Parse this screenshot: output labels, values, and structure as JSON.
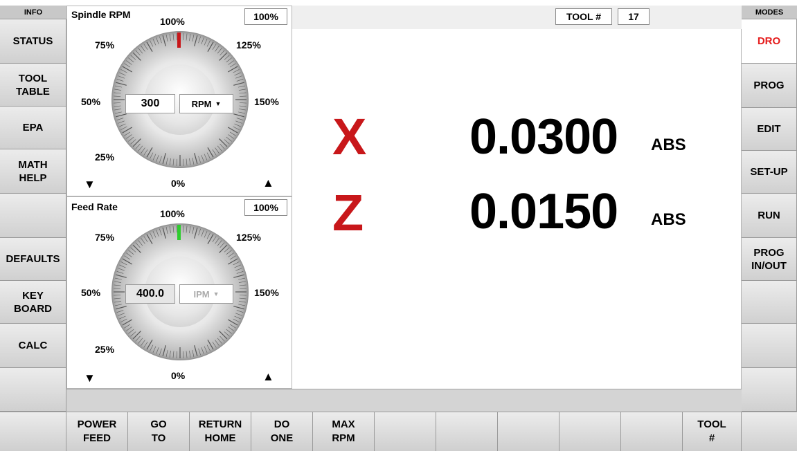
{
  "left_sidebar": {
    "header": "INFO",
    "buttons": [
      {
        "label": "STATUS"
      },
      {
        "label": "TOOL\nTABLE"
      },
      {
        "label": "EPA"
      },
      {
        "label": "MATH\nHELP"
      },
      {
        "label": ""
      },
      {
        "label": "DEFAULTS"
      },
      {
        "label": "KEY\nBOARD"
      },
      {
        "label": "CALC"
      },
      {
        "label": ""
      }
    ]
  },
  "right_sidebar": {
    "header": "MODES",
    "buttons": [
      {
        "label": "DRO"
      },
      {
        "label": "PROG"
      },
      {
        "label": "EDIT"
      },
      {
        "label": "SET-UP"
      },
      {
        "label": "RUN"
      },
      {
        "label": "PROG\nIN/OUT"
      },
      {
        "label": ""
      },
      {
        "label": ""
      },
      {
        "label": ""
      }
    ]
  },
  "spindle": {
    "title": "Spindle RPM",
    "override_pct": "100%",
    "top_label": "100%",
    "labels": {
      "p75": "75%",
      "p125": "125%",
      "p50": "50%",
      "p150": "150%",
      "p25": "25%",
      "p0": "0%"
    },
    "value": "300",
    "unit": "RPM",
    "down_arrow": "▼",
    "up_arrow": "▲",
    "dropdown_arrow": "▼",
    "marker_color": "#c8171a",
    "level": 1.0
  },
  "feed": {
    "title": "Feed Rate",
    "override_pct": "100%",
    "top_label": "100%",
    "labels": {
      "p75": "75%",
      "p125": "125%",
      "p50": "50%",
      "p150": "150%",
      "p25": "25%",
      "p0": "0%"
    },
    "value": "400.0",
    "unit": "IPM",
    "down_arrow": "▼",
    "up_arrow": "▲",
    "dropdown_arrow": "▼",
    "marker_color": "#2ecc2e",
    "level": 1.0
  },
  "tool": {
    "label": "TOOL #",
    "value": "17"
  },
  "dro": {
    "axes": [
      {
        "letter": "X",
        "value": "0.0300",
        "unit": "ABS"
      },
      {
        "letter": "Z",
        "value": "0.0150",
        "unit": "ABS"
      }
    ],
    "axis_color": "#c8171a"
  },
  "bottom_bar": {
    "buttons": [
      {
        "label": ""
      },
      {
        "label": "POWER\nFEED"
      },
      {
        "label": "GO\nTO"
      },
      {
        "label": "RETURN\nHOME"
      },
      {
        "label": "DO\nONE"
      },
      {
        "label": "MAX\nRPM"
      },
      {
        "label": ""
      },
      {
        "label": ""
      },
      {
        "label": ""
      },
      {
        "label": ""
      },
      {
        "label": ""
      },
      {
        "label": "TOOL\n#"
      },
      {
        "label": ""
      }
    ]
  },
  "colors": {
    "active_mode": "#e51b1b",
    "panel_bg": "#c8c8c8"
  }
}
